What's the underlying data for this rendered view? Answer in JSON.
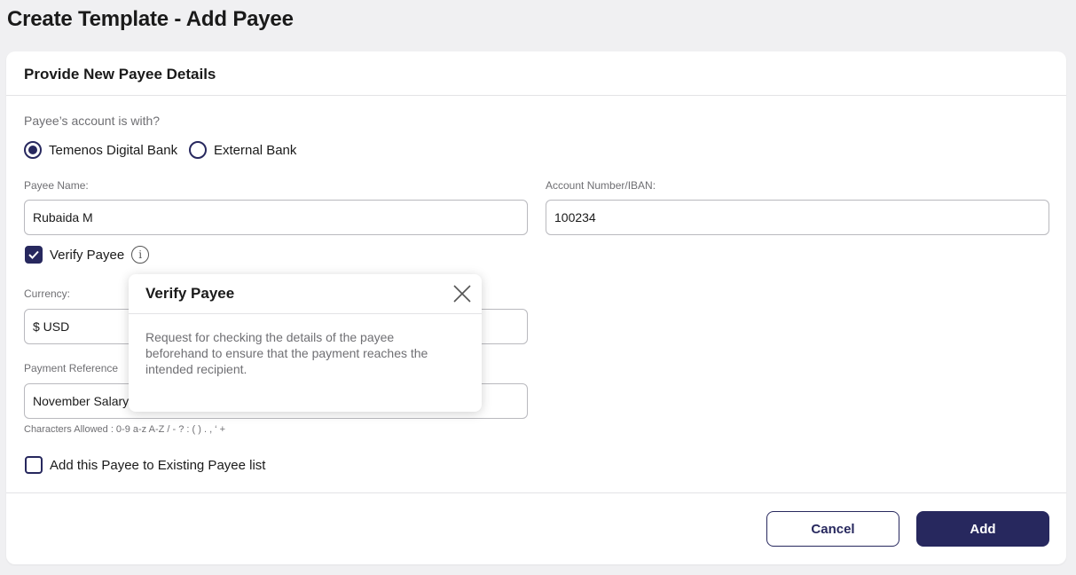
{
  "page": {
    "title": "Create Template - Add Payee"
  },
  "card": {
    "header": "Provide New Payee Details",
    "account_question": "Payee’s account is with?",
    "radios": [
      {
        "label": "Temenos Digital Bank",
        "checked": true
      },
      {
        "label": "External Bank",
        "checked": false
      }
    ],
    "payee_name_label": "Payee Name:",
    "payee_name_value": "Rubaida M",
    "account_label": "Account Number/IBAN:",
    "account_value": "100234",
    "verify_label": "Verify Payee",
    "verify_checked": true,
    "currency_label": "Currency:",
    "currency_value": "$ USD",
    "payment_ref_label": "Payment Reference",
    "payment_ref_value": "November Salary",
    "chars_allowed": "Characters Allowed : 0-9 a-z A-Z / - ? : ( ) . , ‘ +",
    "add_existing_label": "Add this Payee to Existing Payee list",
    "add_existing_checked": false
  },
  "footer": {
    "cancel_label": "Cancel",
    "add_label": "Add"
  },
  "popover": {
    "title": "Verify Payee",
    "body": "Request for checking the details of the payee beforehand to ensure that the payment reaches the intended recipient."
  },
  "colors": {
    "primary": "#27285e",
    "muted_text": "#6f6f73",
    "border": "#b9b9be"
  },
  "icons": [
    "info-icon",
    "close-icon",
    "check-icon"
  ]
}
